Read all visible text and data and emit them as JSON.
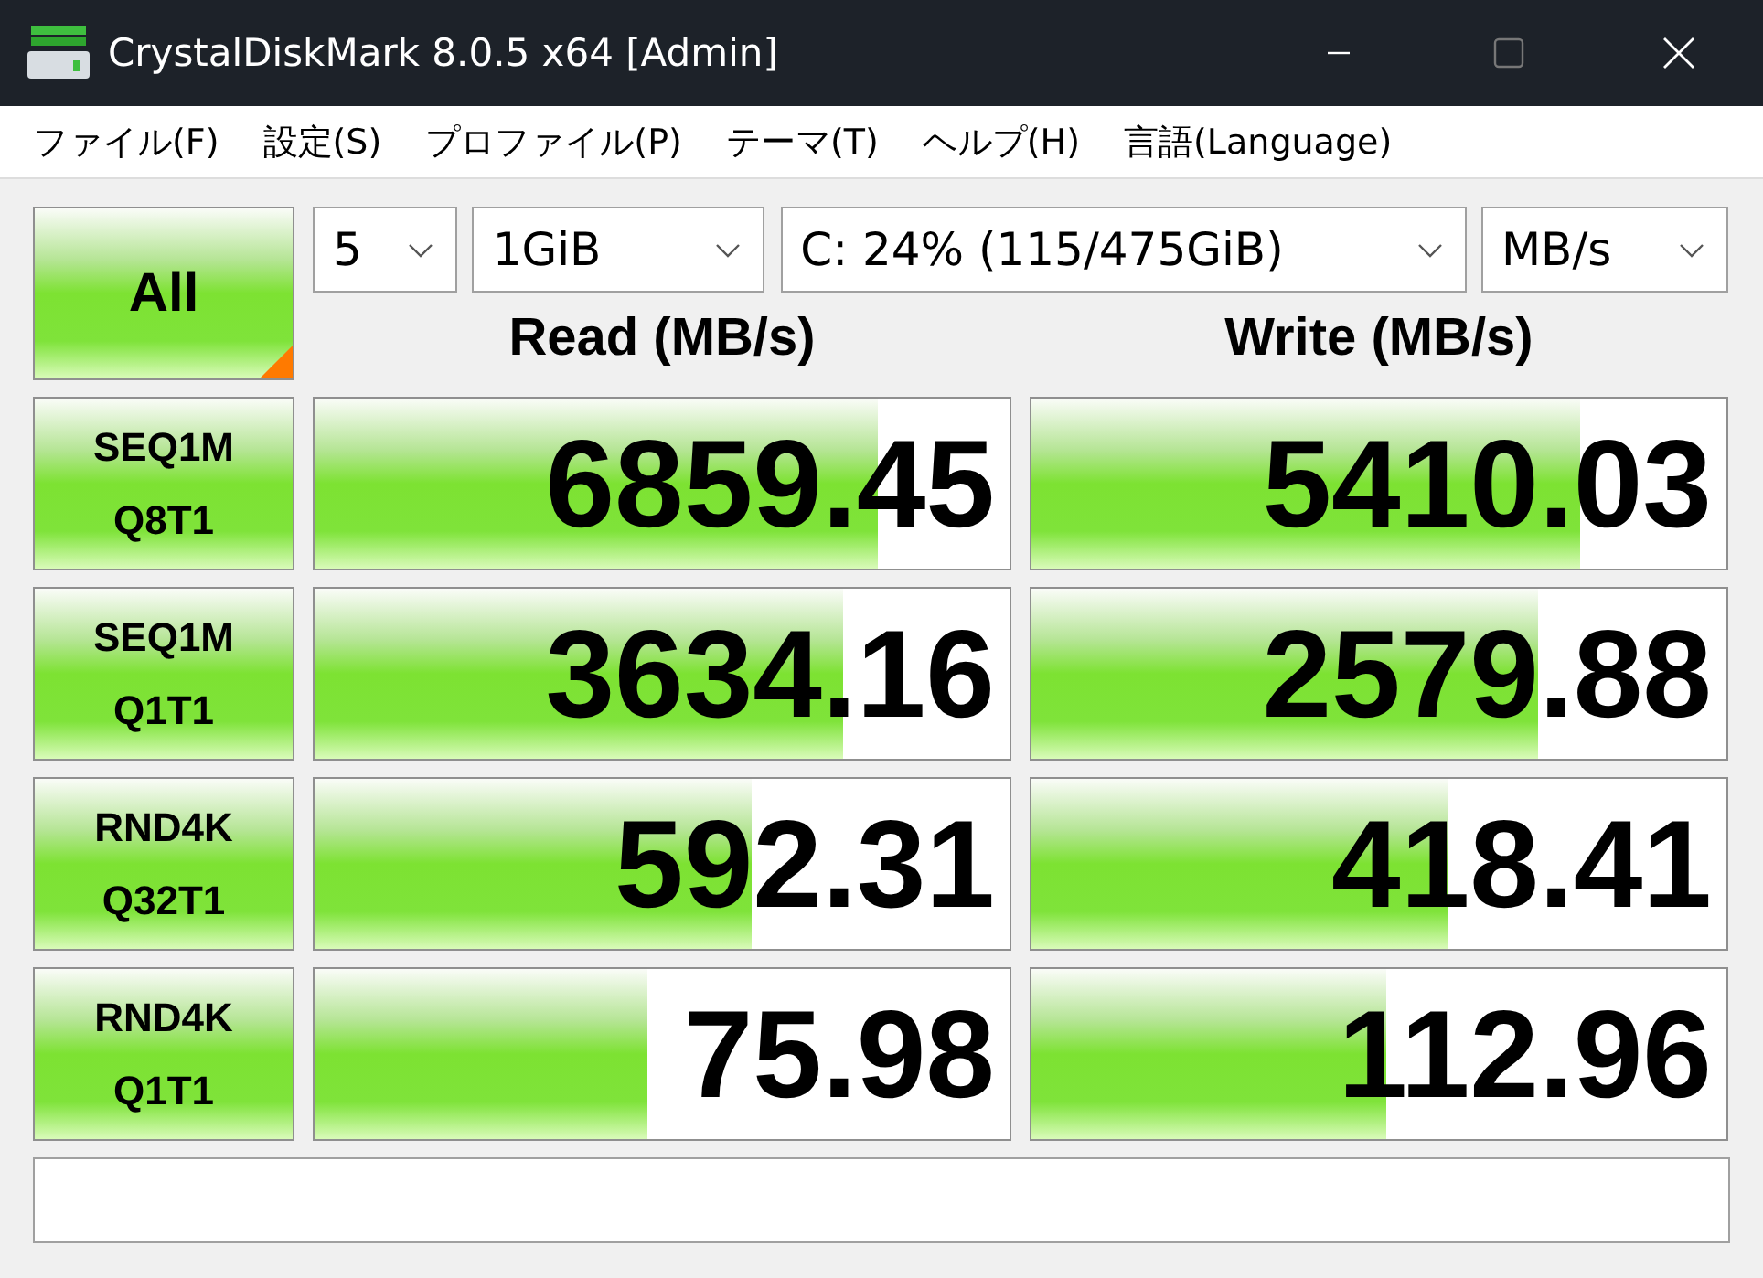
{
  "window": {
    "title": "CrystalDiskMark 8.0.5 x64 [Admin]"
  },
  "menu": [
    "ファイル(F)",
    "設定(S)",
    "プロファイル(P)",
    "テーマ(T)",
    "ヘルプ(H)",
    "言語(Language)"
  ],
  "all_button": {
    "label": "All"
  },
  "selects": [
    {
      "value": "5"
    },
    {
      "value": "1GiB"
    },
    {
      "value": "C: 24% (115/475GiB)"
    },
    {
      "value": "MB/s"
    }
  ],
  "headers": {
    "read": "Read (MB/s)",
    "write": "Write (MB/s)"
  },
  "tests": [
    {
      "label": "SEQ1M\nQ8T1",
      "read": {
        "value": "6859.45",
        "level": 0.81
      },
      "write": {
        "value": "5410.03",
        "level": 0.79
      }
    },
    {
      "label": "SEQ1M\nQ1T1",
      "read": {
        "value": "3634.16",
        "level": 0.76
      },
      "write": {
        "value": "2579.88",
        "level": 0.73
      }
    },
    {
      "label": "RND4K\nQ32T1",
      "read": {
        "value": "592.31",
        "level": 0.63
      },
      "write": {
        "value": "418.41",
        "level": 0.6
      }
    },
    {
      "label": "RND4K\nQ1T1",
      "read": {
        "value": "75.98",
        "level": 0.48
      },
      "write": {
        "value": "112.96",
        "level": 0.51
      }
    }
  ]
}
